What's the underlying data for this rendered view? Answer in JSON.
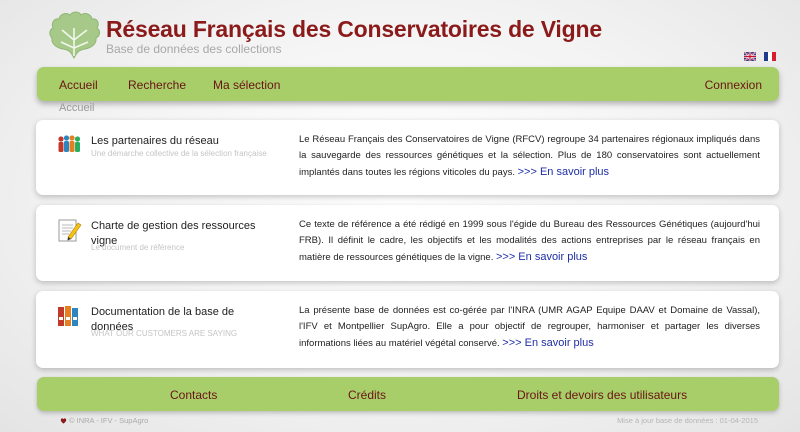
{
  "header": {
    "title": "Réseau Français des Conservatoires de Vigne",
    "subtitle": "Base de données des collections",
    "logo_icon": "vine-leaf-icon",
    "languages": [
      {
        "name": "english-flag-icon",
        "code": "en"
      },
      {
        "name": "french-flag-icon",
        "code": "fr"
      }
    ]
  },
  "nav": {
    "items": [
      "Accueil",
      "Recherche",
      "Ma sélection"
    ],
    "login": "Connexion"
  },
  "breadcrumb": "Accueil",
  "cards": [
    {
      "icon": "people-icon",
      "title": "Les partenaires du réseau",
      "subtitle": "Une démarche collective de la sélection française",
      "text": "Le Réseau Français des Conservatoires de Vigne (RFCV) regroupe 34 partenaires régionaux impliqués dans la sauvegarde des ressources génétiques et la sélection. Plus de 180 conservatoires sont actuellement implantés dans toutes les régions viticoles du pays.",
      "more": ">>> En savoir plus"
    },
    {
      "icon": "document-pencil-icon",
      "title": "Charte de gestion des ressources vigne",
      "subtitle": "Le document de référence",
      "text": "Ce texte de référence a été rédigé en 1999 sous l'égide du Bureau des Ressources Génétiques (aujourd'hui FRB). Il définit le cadre, les objectifs et les modalités des actions entreprises par le réseau français en matière de ressources génétiques de la vigne.",
      "more": ">>> En savoir plus"
    },
    {
      "icon": "binders-icon",
      "title": "Documentation de la base de données",
      "subtitle": "WHAT OUR CUSTOMERS ARE SAYING",
      "text": "La présente base de données est co-gérée par l'INRA (UMR AGAP Equipe DAAV et Domaine de Vassal), l'IFV et Montpellier SupAgro. Elle a pour objectif de regrouper, harmoniser et partager les diverses informations liées au matériel végétal conservé.",
      "more": ">>> En savoir plus"
    }
  ],
  "footer": {
    "links": [
      "Contacts",
      "Crédits",
      "Droits et devoirs des utilisateurs"
    ],
    "copyright": "© INRA - IFV - SupAgro",
    "updated": "Mise à jour base de données : 01-04-2015"
  },
  "colors": {
    "accent_green": "#a8ce6a",
    "title_red": "#8b1a1a",
    "link_blue": "#1f2ea6"
  }
}
